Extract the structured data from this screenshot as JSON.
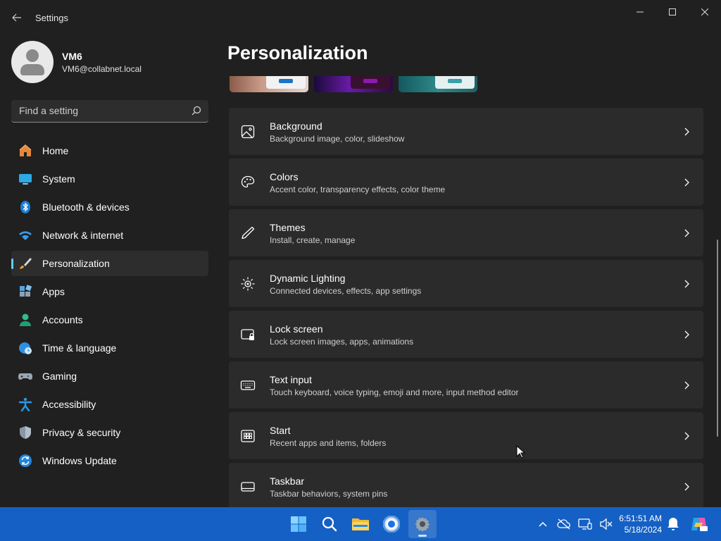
{
  "window": {
    "title": "Settings",
    "controls": [
      "minimize",
      "maximize",
      "close"
    ]
  },
  "profile": {
    "name": "VM6",
    "email": "VM6@collabnet.local"
  },
  "search": {
    "placeholder": "Find a setting"
  },
  "sidebar": {
    "items": [
      {
        "label": "Home",
        "icon": "home-icon"
      },
      {
        "label": "System",
        "icon": "system-icon"
      },
      {
        "label": "Bluetooth & devices",
        "icon": "bluetooth-icon"
      },
      {
        "label": "Network & internet",
        "icon": "wifi-icon"
      },
      {
        "label": "Personalization",
        "icon": "brush-icon",
        "active": true
      },
      {
        "label": "Apps",
        "icon": "apps-icon"
      },
      {
        "label": "Accounts",
        "icon": "accounts-icon"
      },
      {
        "label": "Time & language",
        "icon": "globe-clock-icon"
      },
      {
        "label": "Gaming",
        "icon": "gamepad-icon"
      },
      {
        "label": "Accessibility",
        "icon": "accessibility-icon"
      },
      {
        "label": "Privacy & security",
        "icon": "shield-icon"
      },
      {
        "label": "Windows Update",
        "icon": "update-icon"
      }
    ]
  },
  "main": {
    "title": "Personalization",
    "cards": [
      {
        "title": "Background",
        "subtitle": "Background image, color, slideshow",
        "icon": "image-icon"
      },
      {
        "title": "Colors",
        "subtitle": "Accent color, transparency effects, color theme",
        "icon": "palette-icon"
      },
      {
        "title": "Themes",
        "subtitle": "Install, create, manage",
        "icon": "pen-icon"
      },
      {
        "title": "Dynamic Lighting",
        "subtitle": "Connected devices, effects, app settings",
        "icon": "lighting-icon"
      },
      {
        "title": "Lock screen",
        "subtitle": "Lock screen images, apps, animations",
        "icon": "lock-screen-icon"
      },
      {
        "title": "Text input",
        "subtitle": "Touch keyboard, voice typing, emoji and more, input method editor",
        "icon": "keyboard-icon"
      },
      {
        "title": "Start",
        "subtitle": "Recent apps and items, folders",
        "icon": "start-icon"
      },
      {
        "title": "Taskbar",
        "subtitle": "Taskbar behaviors, system pins",
        "icon": "taskbar-icon"
      }
    ]
  },
  "taskbar": {
    "apps": [
      "start-icon",
      "search-icon",
      "file-explorer-icon",
      "chrome-icon",
      "settings-icon"
    ],
    "time": "6:51:51 AM",
    "date": "5/18/2024"
  },
  "colors": {
    "accent": "#60cdff",
    "taskbar": "#1560c4",
    "window_bg": "#202020",
    "card_bg": "#2b2b2b"
  }
}
